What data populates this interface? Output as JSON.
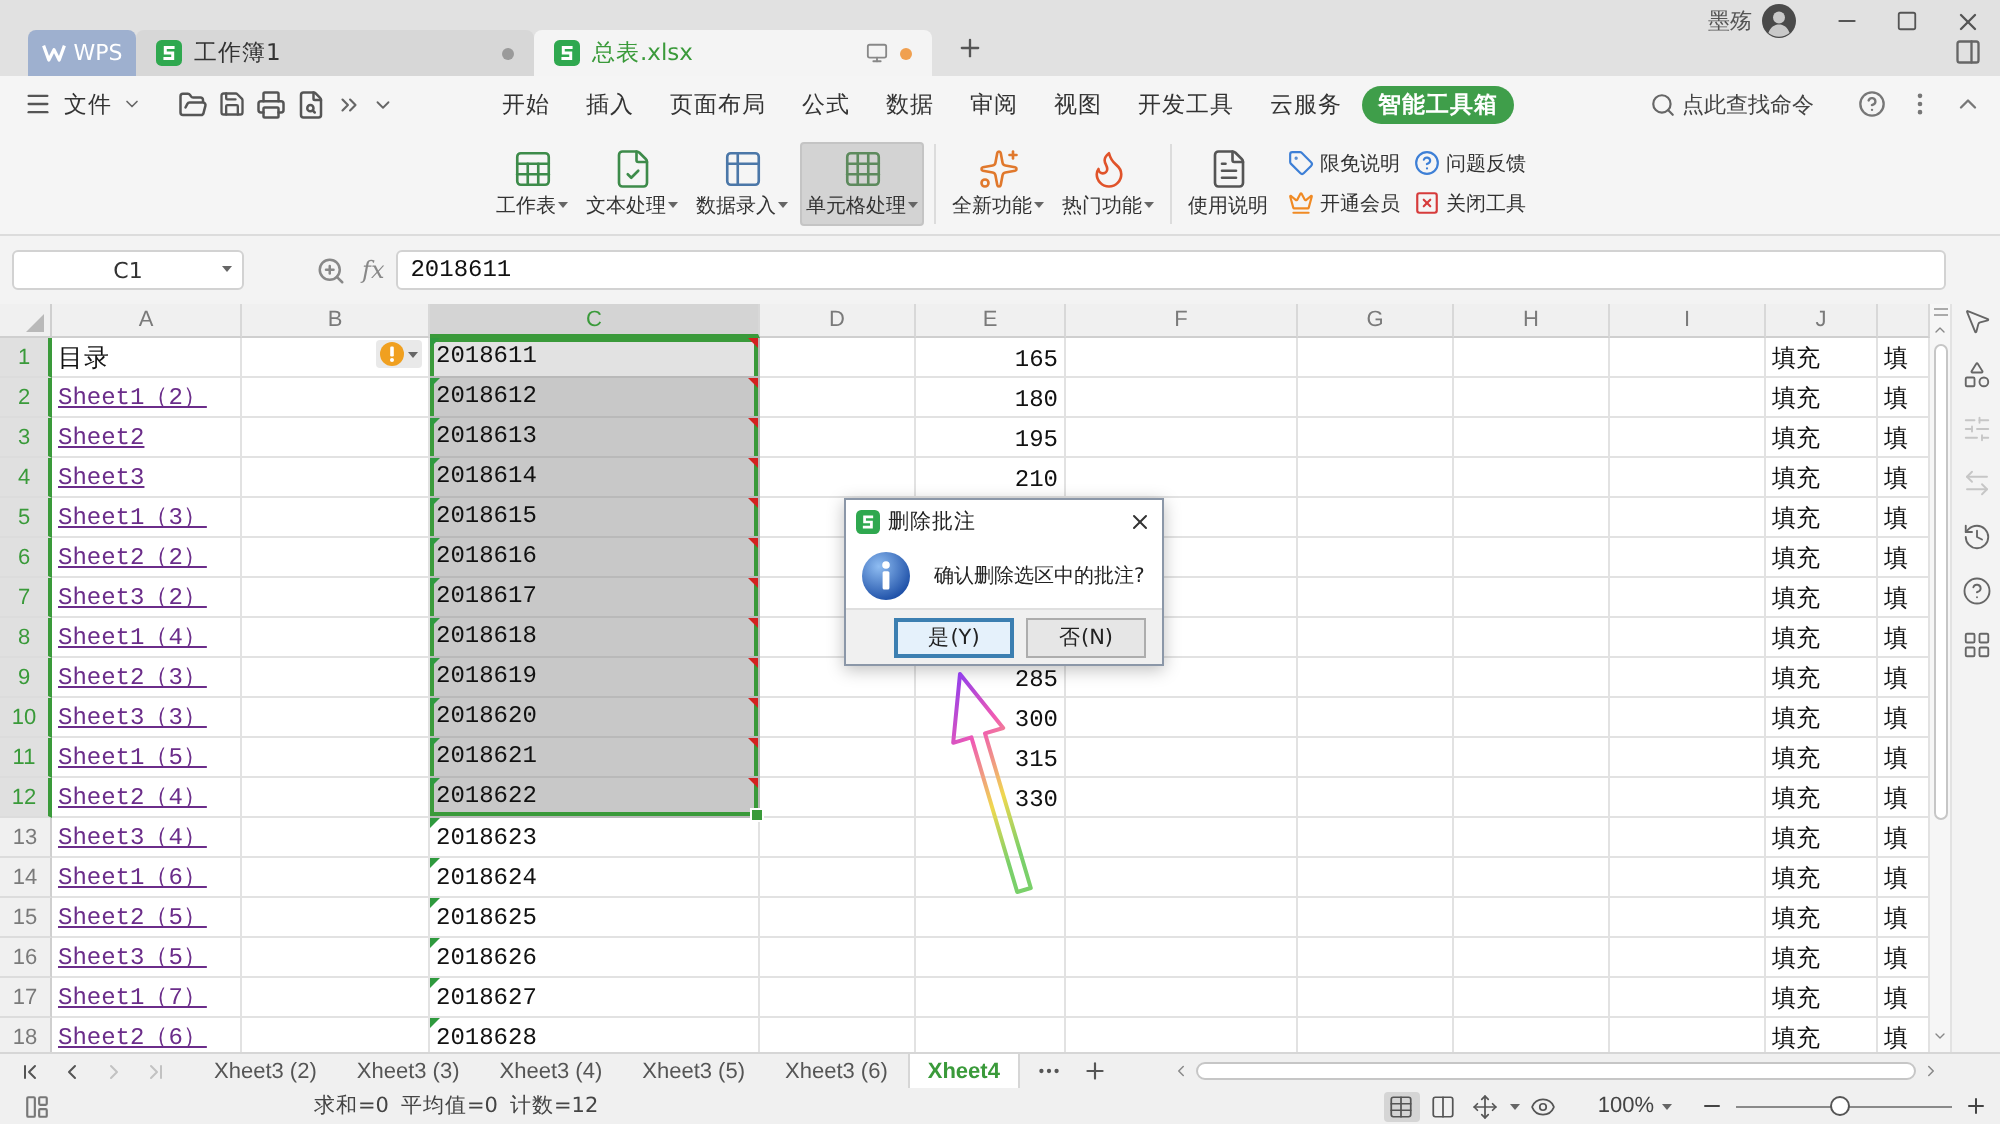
{
  "window": {
    "tabs": [
      {
        "kind": "home",
        "label": "WPS",
        "selected": false
      },
      {
        "kind": "document",
        "label": "工作簿1",
        "selected": false
      },
      {
        "kind": "document",
        "label": "总表.xlsx",
        "selected": true
      }
    ],
    "user": "墨殇"
  },
  "menu": {
    "file_label": "文件",
    "tabs": [
      {
        "label": "开始",
        "selected": false
      },
      {
        "label": "插入",
        "selected": false
      },
      {
        "label": "页面布局",
        "selected": false
      },
      {
        "label": "公式",
        "selected": false
      },
      {
        "label": "数据",
        "selected": false
      },
      {
        "label": "审阅",
        "selected": false
      },
      {
        "label": "视图",
        "selected": false
      },
      {
        "label": "开发工具",
        "selected": false
      },
      {
        "label": "云服务",
        "selected": false
      },
      {
        "label": "智能工具箱",
        "selected": true
      }
    ],
    "search": {
      "placeholder": "点此查找命令"
    }
  },
  "ribbon": {
    "groups": [
      {
        "buttons": [
          {
            "label": "工作表",
            "dropdown": true,
            "selected": false
          },
          {
            "label": "文本处理",
            "dropdown": true,
            "selected": false
          },
          {
            "label": "数据录入",
            "dropdown": true,
            "selected": false
          },
          {
            "label": "单元格处理",
            "dropdown": true,
            "selected": true
          }
        ]
      },
      {
        "buttons": [
          {
            "label": "全新功能",
            "dropdown": true,
            "selected": false
          },
          {
            "label": "热门功能",
            "dropdown": true,
            "selected": false
          }
        ]
      },
      {
        "buttons": [
          {
            "label": "使用说明",
            "dropdown": false,
            "selected": false
          }
        ],
        "links": [
          {
            "label": "限免说明"
          },
          {
            "label": "问题反馈"
          },
          {
            "label": "开通会员"
          },
          {
            "label": "关闭工具"
          }
        ]
      }
    ]
  },
  "formula_bar": {
    "cell_reference": "C1",
    "function_label": "fx",
    "value": "2018611"
  },
  "sheet": {
    "columns": [
      {
        "label": "A",
        "selected": false
      },
      {
        "label": "B",
        "selected": false
      },
      {
        "label": "C",
        "selected": true
      },
      {
        "label": "D",
        "selected": false
      },
      {
        "label": "E",
        "selected": false
      },
      {
        "label": "F",
        "selected": false
      },
      {
        "label": "G",
        "selected": false
      },
      {
        "label": "H",
        "selected": false
      },
      {
        "label": "I",
        "selected": false
      },
      {
        "label": "J",
        "selected": false
      }
    ],
    "rows": [
      {
        "header": "1",
        "selected": true,
        "column_a": {
          "kind": "text",
          "text": "目录"
        },
        "column_b": {
          "warning": true
        },
        "column_c": {
          "value": "2018611",
          "active": true,
          "comment": true,
          "number_as_text": true
        },
        "column_e": "165",
        "column_j": "填充",
        "column_k": "填"
      },
      {
        "header": "2",
        "selected": true,
        "column_a": {
          "kind": "link",
          "text": "Sheet1（2）"
        },
        "column_c": {
          "value": "2018612",
          "active": false,
          "comment": true,
          "number_as_text": true
        },
        "column_e": "180",
        "column_j": "填充",
        "column_k": "填"
      },
      {
        "header": "3",
        "selected": true,
        "column_a": {
          "kind": "link",
          "text": "Sheet2"
        },
        "column_c": {
          "value": "2018613",
          "active": false,
          "comment": true,
          "number_as_text": true
        },
        "column_e": "195",
        "column_j": "填充",
        "column_k": "填"
      },
      {
        "header": "4",
        "selected": true,
        "column_a": {
          "kind": "link",
          "text": "Sheet3"
        },
        "column_c": {
          "value": "2018614",
          "active": false,
          "comment": true,
          "number_as_text": true
        },
        "column_e": "210",
        "column_j": "填充",
        "column_k": "填"
      },
      {
        "header": "5",
        "selected": true,
        "column_a": {
          "kind": "link",
          "text": "Sheet1（3）"
        },
        "column_c": {
          "value": "2018615",
          "active": false,
          "comment": true,
          "number_as_text": true
        },
        "column_j": "填充",
        "column_k": "填"
      },
      {
        "header": "6",
        "selected": true,
        "column_a": {
          "kind": "link",
          "text": "Sheet2（2）"
        },
        "column_c": {
          "value": "2018616",
          "active": false,
          "comment": true,
          "number_as_text": true
        },
        "column_j": "填充",
        "column_k": "填"
      },
      {
        "header": "7",
        "selected": true,
        "column_a": {
          "kind": "link",
          "text": "Sheet3（2）"
        },
        "column_c": {
          "value": "2018617",
          "active": false,
          "comment": true,
          "number_as_text": true
        },
        "column_j": "填充",
        "column_k": "填"
      },
      {
        "header": "8",
        "selected": true,
        "column_a": {
          "kind": "link",
          "text": "Sheet1（4）"
        },
        "column_c": {
          "value": "2018618",
          "active": false,
          "comment": true,
          "number_as_text": true
        },
        "column_j": "填充",
        "column_k": "填"
      },
      {
        "header": "9",
        "selected": true,
        "column_a": {
          "kind": "link",
          "text": "Sheet2（3）"
        },
        "column_c": {
          "value": "2018619",
          "active": false,
          "comment": true,
          "number_as_text": true
        },
        "column_e": "285",
        "column_j": "填充",
        "column_k": "填"
      },
      {
        "header": "10",
        "selected": true,
        "column_a": {
          "kind": "link",
          "text": "Sheet3（3）"
        },
        "column_c": {
          "value": "2018620",
          "active": false,
          "comment": true,
          "number_as_text": true
        },
        "column_e": "300",
        "column_j": "填充",
        "column_k": "填"
      },
      {
        "header": "11",
        "selected": true,
        "column_a": {
          "kind": "link",
          "text": "Sheet1（5）"
        },
        "column_c": {
          "value": "2018621",
          "active": false,
          "comment": true,
          "number_as_text": true
        },
        "column_e": "315",
        "column_j": "填充",
        "column_k": "填"
      },
      {
        "header": "12",
        "selected": true,
        "column_a": {
          "kind": "link",
          "text": "Sheet2（4）"
        },
        "column_c": {
          "value": "2018622",
          "active": false,
          "comment": true,
          "number_as_text": true
        },
        "column_e": "330",
        "column_j": "填充",
        "column_k": "填"
      },
      {
        "header": "13",
        "selected": false,
        "column_a": {
          "kind": "link",
          "text": "Sheet3（4）"
        },
        "column_c": {
          "value": "2018623",
          "active": false,
          "comment": false,
          "number_as_text": true
        },
        "column_j": "填充",
        "column_k": "填"
      },
      {
        "header": "14",
        "selected": false,
        "column_a": {
          "kind": "link",
          "text": "Sheet1（6）"
        },
        "column_c": {
          "value": "2018624",
          "active": false,
          "comment": false,
          "number_as_text": true
        },
        "column_j": "填充",
        "column_k": "填"
      },
      {
        "header": "15",
        "selected": false,
        "column_a": {
          "kind": "link",
          "text": "Sheet2（5）"
        },
        "column_c": {
          "value": "2018625",
          "active": false,
          "comment": false,
          "number_as_text": true
        },
        "column_j": "填充",
        "column_k": "填"
      },
      {
        "header": "16",
        "selected": false,
        "column_a": {
          "kind": "link",
          "text": "Sheet3（5）"
        },
        "column_c": {
          "value": "2018626",
          "active": false,
          "comment": false,
          "number_as_text": true
        },
        "column_j": "填充",
        "column_k": "填"
      },
      {
        "header": "17",
        "selected": false,
        "column_a": {
          "kind": "link",
          "text": "Sheet1（7）"
        },
        "column_c": {
          "value": "2018627",
          "active": false,
          "comment": false,
          "number_as_text": true
        },
        "column_j": "填充",
        "column_k": "填"
      },
      {
        "header": "18",
        "selected": false,
        "column_a": {
          "kind": "link",
          "text": "Sheet2（6）"
        },
        "column_c": {
          "value": "2018628",
          "active": false,
          "comment": false,
          "number_as_text": true
        },
        "column_j": "填充",
        "column_k": "填"
      }
    ]
  },
  "dialog": {
    "title": "删除批注",
    "message": "确认删除选区中的批注?",
    "buttons": [
      {
        "label": "是(Y)",
        "default": true
      },
      {
        "label": "否(N)",
        "default": false
      }
    ]
  },
  "sidebar_tools": [
    {
      "disabled": false
    },
    {
      "disabled": false
    },
    {
      "disabled": true
    },
    {
      "disabled": true
    },
    {
      "disabled": false
    },
    {
      "disabled": false
    },
    {
      "disabled": false
    }
  ],
  "sheet_tabs": {
    "navigation": [
      {
        "disabled": false
      },
      {
        "disabled": false
      },
      {
        "disabled": true
      },
      {
        "disabled": true
      }
    ],
    "tabs": [
      {
        "label": "Xheet3 (2)",
        "selected": false
      },
      {
        "label": "Xheet3 (3)",
        "selected": false
      },
      {
        "label": "Xheet3 (4)",
        "selected": false
      },
      {
        "label": "Xheet3 (5)",
        "selected": false
      },
      {
        "label": "Xheet3 (6)",
        "selected": false
      },
      {
        "label": "Xheet4",
        "selected": true
      }
    ]
  },
  "status_bar": {
    "items": [
      "求和=0",
      "平均值=0",
      "计数=12"
    ],
    "view_modes": [
      {
        "selected": true
      },
      {
        "selected": false
      },
      {
        "selected": false
      },
      {
        "selected": false
      }
    ],
    "zoom": "100%",
    "zoom_slider": {
      "level": 0.48
    }
  }
}
